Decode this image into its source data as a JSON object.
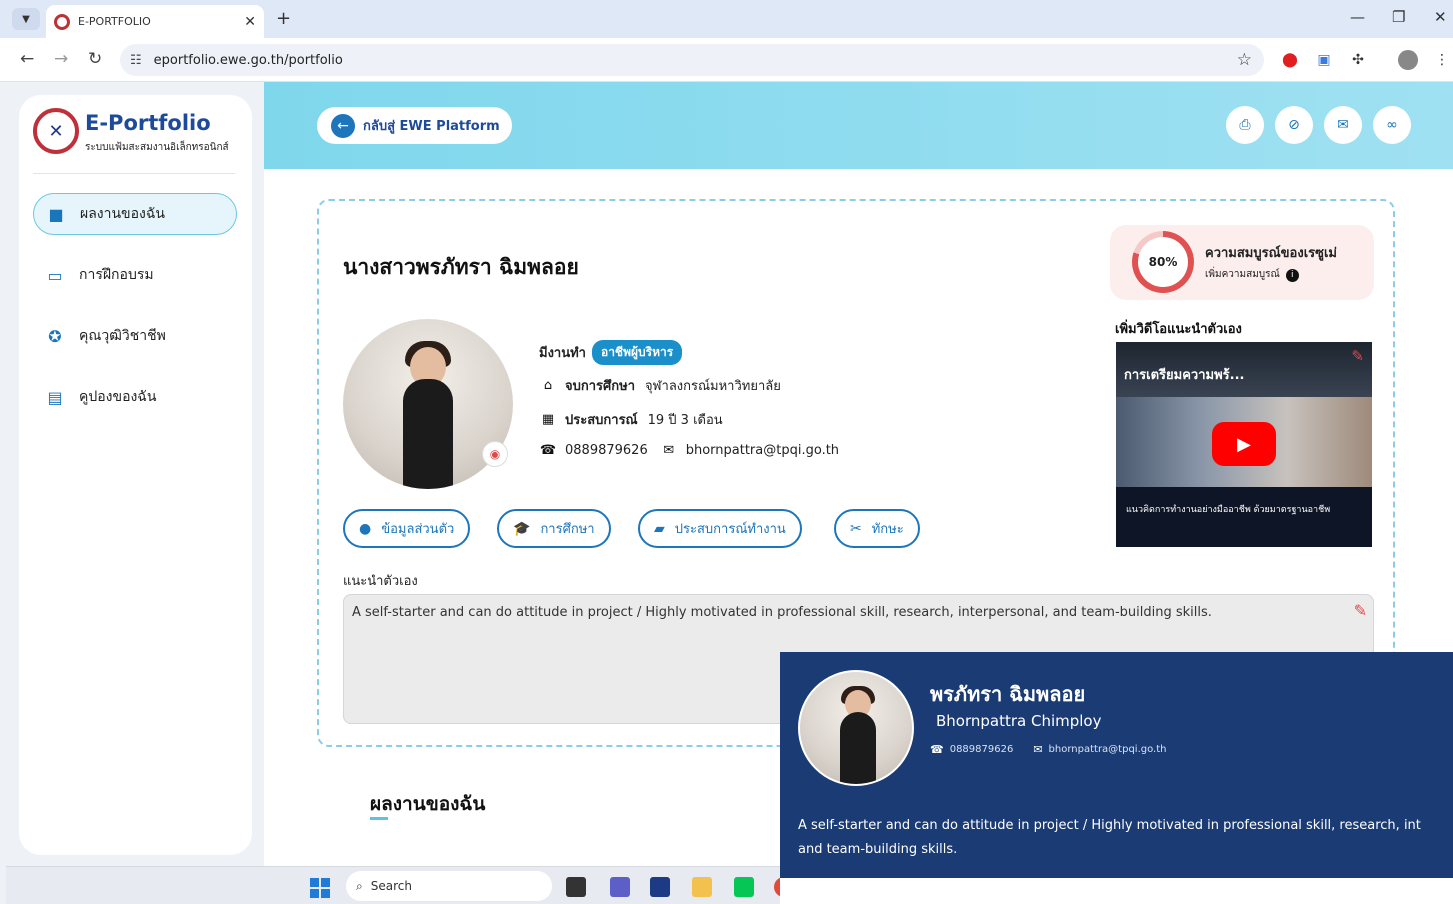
{
  "browser": {
    "tab_title": "E-PORTFOLIO",
    "url": "eportfolio.ewe.go.th/portfolio"
  },
  "sidebar": {
    "logo_title": "E-Portfolio",
    "logo_sub": "ระบบแฟ้มสะสมงานอิเล็กทรอนิกส์",
    "items": [
      {
        "label": "ผลงานของฉัน",
        "icon": "folder-icon",
        "active": true
      },
      {
        "label": "การฝึกอบรม",
        "icon": "laptop-icon",
        "active": false
      },
      {
        "label": "คุณวุฒิวิชาชีพ",
        "icon": "award-icon",
        "active": false
      },
      {
        "label": "คูปองของฉัน",
        "icon": "ticket-icon",
        "active": false
      }
    ]
  },
  "header": {
    "back_label": "กลับสู่ EWE Platform",
    "actions": [
      "print-icon",
      "eye-slash-icon",
      "envelope-icon",
      "link-icon"
    ]
  },
  "profile": {
    "name": "นางสาวพรภัทรา ฉิมพลอย",
    "completeness": {
      "percent_label": "80%",
      "percent": 80,
      "title": "ความสมบูรณ์ของเรซูเม่",
      "subtitle": "เพิ่มความสมบูรณ์"
    },
    "employment_label": "มีงานทำ",
    "employment_badge": "อาชีพผู้บริหาร",
    "education_key": "จบการศึกษา",
    "education_value": "จุฬาลงกรณ์มหาวิทยาลัย",
    "experience_key": "ประสบการณ์",
    "experience_value": "19 ปี 3 เดือน",
    "phone": "0889879626",
    "email": "bhornpattra@tpqi.go.th",
    "video_title": "เพิ่มวิดีโอแนะนำตัวเอง",
    "video_caption": "การเตรียมความพร้...",
    "video_strip": "แนวคิดการทำงานอย่างมืออาชีพ ด้วยมาตรฐานอาชีพ",
    "tabs": [
      "ข้อมูลส่วนตัว",
      "การศึกษา",
      "ประสบการณ์ทำงาน",
      "ทักษะ"
    ],
    "intro_label": "แนะนำตัวเอง",
    "intro_text": "A self-starter and can do attitude in project / Highly motivated in professional skill, research, interpersonal, and team-building skills."
  },
  "works": {
    "title": "ผลงานของฉัน"
  },
  "taskbar": {
    "search_label": "Search"
  },
  "preview": {
    "name_th": "พรภัทรา ฉิมพลอย",
    "name_en": "Bhornpattra Chimploy",
    "phone": "0889879626",
    "email": "bhornpattra@tpqi.go.th",
    "bio_line1": "A self-starter and can do attitude in project / Highly motivated in professional skill, research, int",
    "bio_line2": "and team-building skills."
  }
}
